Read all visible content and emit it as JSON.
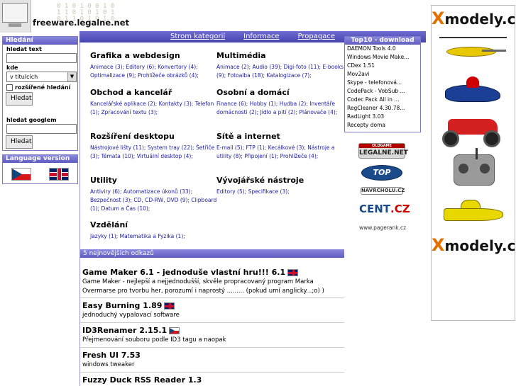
{
  "header": {
    "site_title": "freeware.legalne.net",
    "binary_deco": "0 1 0 1 0 0 1 0\n1 1 0 1 0 1 0 1\n0 1 1 0 1 0 1 0"
  },
  "topnav": {
    "items": [
      "Strom kategorií",
      "Informace",
      "Propagace"
    ]
  },
  "search": {
    "title": "Hledání",
    "text_label": "hledat text",
    "where_label": "kde",
    "where_value": "v titulcích",
    "extended_label": "rozšířené hledání",
    "search_button": "Hledat",
    "google_label": "hledat googlem",
    "google_button": "Hledat"
  },
  "language": {
    "title": "Language version"
  },
  "categories": [
    {
      "title": "Grafika a webdesign",
      "links": [
        "Animace (3);",
        "Editory (6);",
        "Konvertory (4);",
        "Optimalizace (9);",
        "Prohlížeče obrázků (4);"
      ]
    },
    {
      "title": "Multimédia",
      "links": [
        "Animace (2);",
        "Audio (39);",
        "Digi-foto (11);",
        "E-books (9);",
        "Fotoalba (18);",
        "Katalogizace (7);"
      ]
    },
    {
      "title": "Obchod a kancelář",
      "links": [
        "Kancelářské aplikace (2);",
        "Kontakty (3);",
        "Telefon (1);",
        "Zpracování textu (3);"
      ]
    },
    {
      "title": "Osobní a domácí",
      "links": [
        "Finance (6);",
        "Hobby (1);",
        "Hudba (2);",
        "Inventáře domácnosti (2);",
        "Jídlo a pití (2);",
        "Plánovače (4);"
      ]
    },
    {
      "title": "Rozšíření desktopu",
      "links": [
        "Nástrojové lišty (11);",
        "System tray (22);",
        "Šetřiče (3);",
        "Témata (10);",
        "Virtuální desktop (4);"
      ]
    },
    {
      "title": "Sítě a internet",
      "links": [
        "E-mail (5);",
        "FTP (1);",
        "Kecálkové (3);",
        "Nástroje a utility (8);",
        "Připojení (1);",
        "Prohlížeče (4);"
      ]
    },
    {
      "title": "Utility",
      "links": [
        "Antiviry (6);",
        "Automatizace úkonů (33);",
        "Bezpečnost (3);",
        "CD, CD-RW, DVD (9);",
        "Clipboard (1);",
        "Datum a Čas (10);"
      ]
    },
    {
      "title": "Vývojářské nástroje",
      "links": [
        "Editory (5);",
        "Specifikace (3);"
      ]
    },
    {
      "title": "Vzdělání",
      "links": [
        "Jazyky (1);",
        "Matematika a Fyzika (1);"
      ]
    }
  ],
  "latest": {
    "title": "5 nejnovějších odkazů",
    "items": [
      {
        "title": "Game Maker 6.1 - jednoduše vlastní hru!!! 6.1",
        "flag": "uk",
        "desc": "Game Maker - nejlepší a nejjednodušší, skvěle propracovaný program Marka Overmarse pro tvorbu her, porozumí i naprostý ......... (pokud umí anglicky...;o) )"
      },
      {
        "title": "Easy Burning 1.89",
        "flag": "uk",
        "desc": "jednoduchý vypalovací software"
      },
      {
        "title": "ID3Renamer 2.15.1",
        "flag": "cz",
        "desc": "Přejmenování souboru podle ID3 tagu a naopak"
      },
      {
        "title": "Fresh UI 7.53",
        "flag": "",
        "desc": "windows tweaker"
      },
      {
        "title": "Fuzzy Duck RSS Reader 1.3",
        "flag": "",
        "desc": ""
      }
    ]
  },
  "top10": {
    "title": "Top10 - download",
    "items": [
      "DAEMON Tools 4.0",
      "Windows Movie Make...",
      "CDex 1.51",
      "Mov2avi",
      "Skype - telefonová...",
      "CodePack - VobSub ...",
      "Codec Pack All in ...",
      "RegCleaner 4.30.78...",
      "RadLight 3.03",
      "Recepty doma"
    ]
  },
  "badges": {
    "legalne_small": "OLDGAME",
    "legalne_big": "LEGALNE.NET",
    "top": "TOP",
    "navrcholu": "NAVRCHOLU.CZ",
    "cent_left": "CENT",
    "cent_right": ".CZ",
    "pagerank": "www.pagerank.cz"
  },
  "ad": {
    "logo_x": "X",
    "logo_rest": "modely.cz",
    "accent": "#e07000"
  }
}
